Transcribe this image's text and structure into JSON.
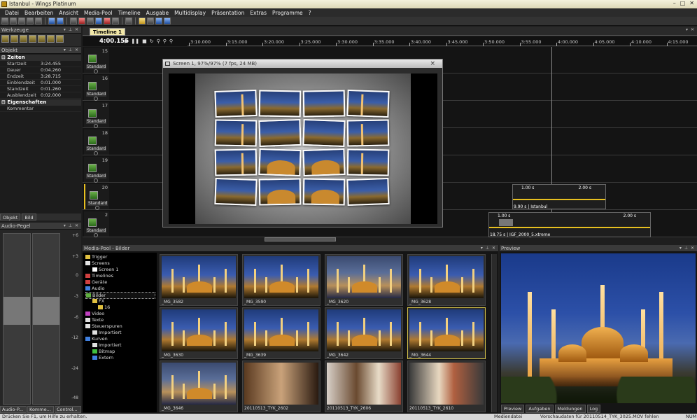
{
  "window": {
    "title": "Istanbul - Wings Platinum"
  },
  "menu": [
    "Datei",
    "Bearbeiten",
    "Ansicht",
    "Media-Pool",
    "Timeline",
    "Ausgabe",
    "Multidisplay",
    "Präsentation",
    "Extras",
    "Programme",
    "?"
  ],
  "panels": {
    "werkzeuge": "Werkzeuge",
    "objekt": "Objekt",
    "audio": "Audio-Pegel",
    "media_pool": "Media-Pool - Bilder",
    "preview": "Preview"
  },
  "object_props": {
    "zeiten_label": "Zeiten",
    "rows": [
      {
        "k": "Startzeit",
        "v": "3:24.455"
      },
      {
        "k": "Dauer",
        "v": "0:04.260"
      },
      {
        "k": "Endzeit",
        "v": "3:28.715"
      },
      {
        "k": "Einblendzeit",
        "v": "0:01.000"
      },
      {
        "k": "Standzeit",
        "v": "0:01.260"
      },
      {
        "k": "Ausblendzeit",
        "v": "0:02.000"
      }
    ],
    "eigenschaften_label": "Eigenschaften",
    "kommentar_label": "Kommentar"
  },
  "object_tabs": [
    "Objekt",
    "Bild"
  ],
  "audio_scale": [
    "+6",
    "+3",
    "0",
    "-3",
    "-6",
    "-12",
    "-24",
    "-48"
  ],
  "left_bottom_tabs": [
    "Audio-P...",
    "Komme...",
    "Control..."
  ],
  "timeline": {
    "tab": "Timeline 1",
    "time": "4:00.155",
    "ruler": [
      "3:10.000",
      "3:15.000",
      "3:20.000",
      "3:25.000",
      "3:30.000",
      "3:35.000",
      "3:40.000",
      "3:45.000",
      "3:50.000",
      "3:55.000",
      "4:00.000",
      "4:05.000",
      "4:10.000",
      "4:15.000"
    ],
    "tracks": [
      {
        "num": "15",
        "label": "Standard"
      },
      {
        "num": "16",
        "label": "Standard"
      },
      {
        "num": "17",
        "label": "Standard"
      },
      {
        "num": "18",
        "label": "Standard"
      },
      {
        "num": "19",
        "label": "Standard"
      },
      {
        "num": "20",
        "label": "Standard"
      },
      {
        "num": "2",
        "label": "Standard"
      }
    ],
    "clip1": {
      "in": "1.00 s",
      "out": "2.00 s",
      "label": "9.90 s | Istanbul"
    },
    "clip2": {
      "in": "1.00 s",
      "out": "2.00 s",
      "label": "18.75 s | IGF_2000_5.xtreme"
    }
  },
  "screen_window": {
    "title": "Screen 1, 97%/97% (7 fps, 24 MB)",
    "close": "×"
  },
  "tree": [
    {
      "label": "Trigger",
      "icon": "trigger-icon",
      "color": "#e0c040"
    },
    {
      "label": "Screens",
      "icon": "screens-icon",
      "color": "#e0e0e0"
    },
    {
      "label": "Screen 1",
      "icon": "screen-icon",
      "color": "#ffffff"
    },
    {
      "label": "Timelines",
      "icon": "timeline-icon",
      "color": "#d04040"
    },
    {
      "label": "Geräte",
      "icon": "devices-icon",
      "color": "#d04040"
    },
    {
      "label": "Audio",
      "icon": "audio-icon",
      "color": "#4080e0"
    },
    {
      "label": "Bilder",
      "icon": "image-icon",
      "color": "#60b040"
    },
    {
      "label": "FX",
      "icon": "folder-icon",
      "color": "#e0c040"
    },
    {
      "label": "16",
      "icon": "folder-icon",
      "color": "#e0c040"
    },
    {
      "label": "Video",
      "icon": "video-icon",
      "color": "#c040c0"
    },
    {
      "label": "Texte",
      "icon": "text-icon",
      "color": "#e0e0e0"
    },
    {
      "label": "Steuerspuren",
      "icon": "control-icon",
      "color": "#e0e0e0"
    },
    {
      "label": "Importiert",
      "icon": "import-icon",
      "color": "#e0e0e0"
    },
    {
      "label": "Kurven",
      "icon": "curve-icon",
      "color": "#4080e0"
    },
    {
      "label": "Importiert",
      "icon": "import-icon",
      "color": "#e0e0e0"
    },
    {
      "label": "Bitmap",
      "icon": "bitmap-icon",
      "color": "#40c040"
    },
    {
      "label": "Extern",
      "icon": "extern-icon",
      "color": "#4080e0"
    }
  ],
  "thumbnails": [
    "_MG_3582",
    "_MG_3590",
    "_MG_3620",
    "_MG_3628",
    "_MG_3630",
    "_MG_3639",
    "_MG_3642",
    "_MG_3644",
    "_MG_3646",
    "20110513_TYK_2602",
    "20110513_TYK_2606",
    "20110513_TYK_2610"
  ],
  "preview_tabs": [
    "Preview",
    "Aufgaben",
    "Meldungen",
    "Log"
  ],
  "status": {
    "help": "Drücken Sie F1, um Hilfe zu erhalten.",
    "media": "Mediendatei",
    "warning": "Vorschaudaten für 20110514_TYK_3025.MOV fehlen",
    "num": "NUM"
  },
  "colors": {
    "accent": "#f2e8a8",
    "clip_bar": "#e8c020",
    "selection": "#d4c24a"
  }
}
